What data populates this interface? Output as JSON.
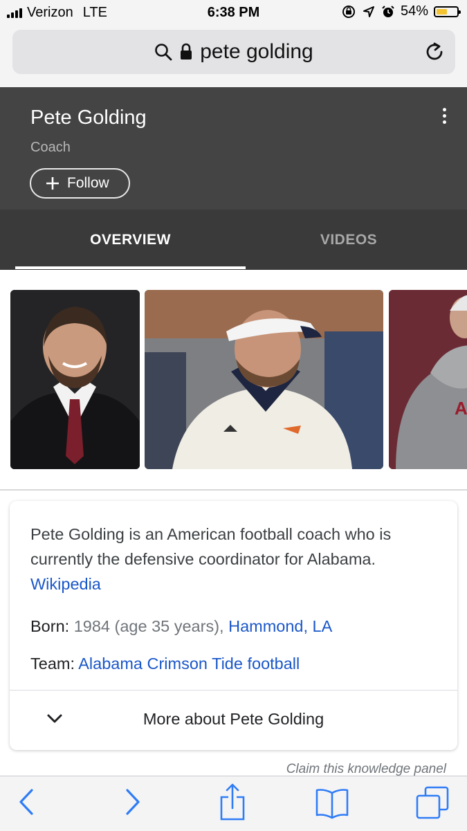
{
  "status_bar": {
    "carrier": "Verizon",
    "network": "LTE",
    "time": "6:38 PM",
    "battery_percent": "54%",
    "battery_level": 0.54
  },
  "browser": {
    "search_text": "pete golding"
  },
  "knowledge_panel": {
    "title": "Pete Golding",
    "subtitle": "Coach",
    "follow_label": "Follow",
    "tabs": [
      {
        "label": "OVERVIEW",
        "active": true
      },
      {
        "label": "VIDEOS",
        "active": false
      }
    ]
  },
  "info_card": {
    "description": "Pete Golding is an American football coach who is currently the defensive coordinator for Alabama.",
    "source_link": "Wikipedia",
    "born_label": "Born:",
    "born_value": "1984 (age 35 years),",
    "born_place": "Hammond, LA",
    "team_label": "Team:",
    "team_value": "Alabama Crimson Tide football",
    "more_label": "More about Pete Golding"
  },
  "claim_link": "Claim this knowledge panel",
  "colors": {
    "header_bg": "#444445",
    "tabs_bg": "#3a3a3b",
    "link": "#1a57c8",
    "ios_blue": "#2f7cf6",
    "battery_fill": "#f4c430"
  },
  "icons": [
    "search-icon",
    "lock-icon",
    "reload-icon",
    "more-vert-icon",
    "plus-icon",
    "chevron-down-icon",
    "back-icon",
    "forward-icon",
    "share-icon",
    "bookmarks-icon",
    "tabs-icon"
  ]
}
